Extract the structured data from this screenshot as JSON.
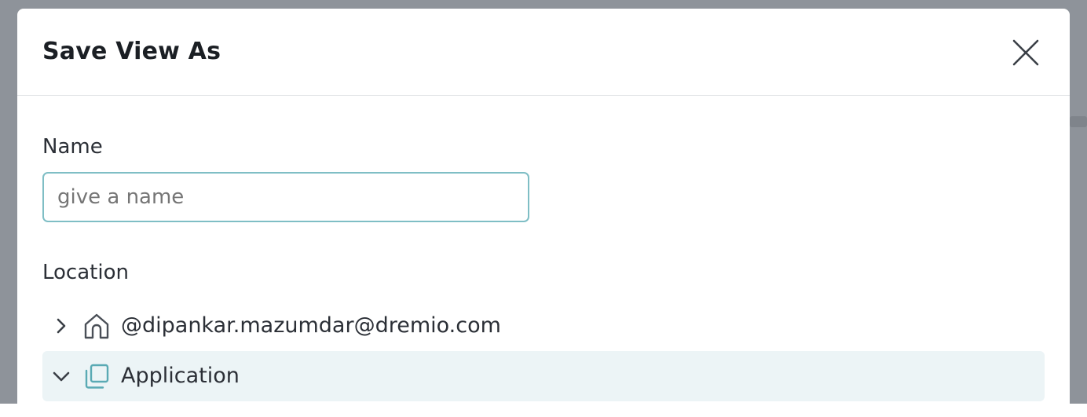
{
  "dialog": {
    "title": "Save View As",
    "close_icon": "close-icon"
  },
  "name_field": {
    "label": "Name",
    "placeholder": "give a name",
    "value": ""
  },
  "location": {
    "label": "Location",
    "items": [
      {
        "label": "@dipankar.mazumdar@dremio.com",
        "icon": "home-icon",
        "expanded": false,
        "selected": false
      },
      {
        "label": "Application",
        "icon": "space-icon",
        "expanded": true,
        "selected": true
      }
    ]
  },
  "colors": {
    "backdrop": "#8e939a",
    "input_border": "#7fbec5",
    "selected_row_bg": "#ecf4f6",
    "space_icon": "#5aaab4"
  }
}
